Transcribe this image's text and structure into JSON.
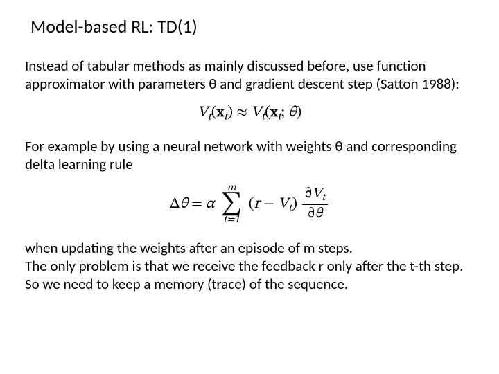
{
  "title": "Model-based RL: TD(1)",
  "para1": "Instead of tabular methods as mainly discussed before, use function approximator with parameters θ and gradient descent step (Satton 1988):",
  "eq1_lhs_V": "V",
  "eq1_lhs_sub": "t",
  "eq1_lhs_xbold": "x",
  "eq1_lhs_xsub": "t",
  "eq1_approx": "≈",
  "eq1_rhs_V": "V",
  "eq1_rhs_sub": "t",
  "eq1_rhs_xbold": "x",
  "eq1_rhs_xsub": "t",
  "eq1_theta": "θ",
  "para2": "For example by using a neural network with weights θ and corresponding delta learning rule",
  "eq2_delta": "Δ",
  "eq2_theta": "θ",
  "eq2_eq": "=",
  "eq2_alpha": "α",
  "eq2_sum_top": "m",
  "eq2_sum_bot": "t=1",
  "eq2_paren_l": "(",
  "eq2_r": "r",
  "eq2_minus": " − ",
  "eq2_V": "V",
  "eq2_Vsub": "t",
  "eq2_paren_r": ")",
  "eq2_frac_num_d": "∂",
  "eq2_frac_num_V": "V",
  "eq2_frac_num_sub": "t",
  "eq2_frac_den_d": "∂",
  "eq2_frac_den_th": "θ",
  "para3": "when updating the weights after an episode of m steps.\nThe only problem is that we receive the feedback r only after the t-th step. So we need to keep a memory (trace) of the sequence."
}
